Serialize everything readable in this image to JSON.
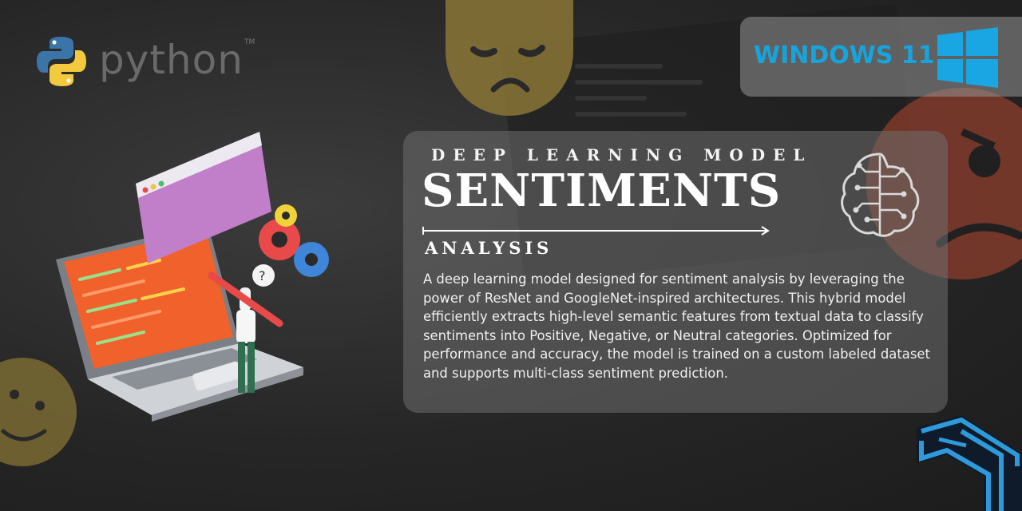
{
  "logo": {
    "python_word": "python",
    "tm": "TM",
    "windows_text": "WINDOWS 11"
  },
  "header": {
    "kicker": "DEEP LEARNING MODEL",
    "title": "SENTIMENTS",
    "subtitle": "ANALYSIS"
  },
  "description": "A deep learning model designed for sentiment analysis by leveraging the power of ResNet and GoogleNet-inspired architectures. This hybrid model efficiently extracts high-level semantic features from textual data to classify sentiments into Positive, Negative, or Neutral categories. Optimized for performance and accuracy, the model is trained on a custom labeled dataset and supports multi-class sentiment prediction.",
  "colors": {
    "windows_blue": "#17a4dc",
    "emoji_yellow": "#d4b24a",
    "emoji_red": "#c9553a",
    "brand_icon_blue": "#2f9ad9"
  },
  "icons": [
    "python-logo-icon",
    "windows-logo-icon",
    "brain-circuit-icon",
    "brand-mark-icon",
    "laptop-illustration",
    "sad-emoji-icon",
    "angry-emoji-icon",
    "happy-emoji-icon"
  ]
}
